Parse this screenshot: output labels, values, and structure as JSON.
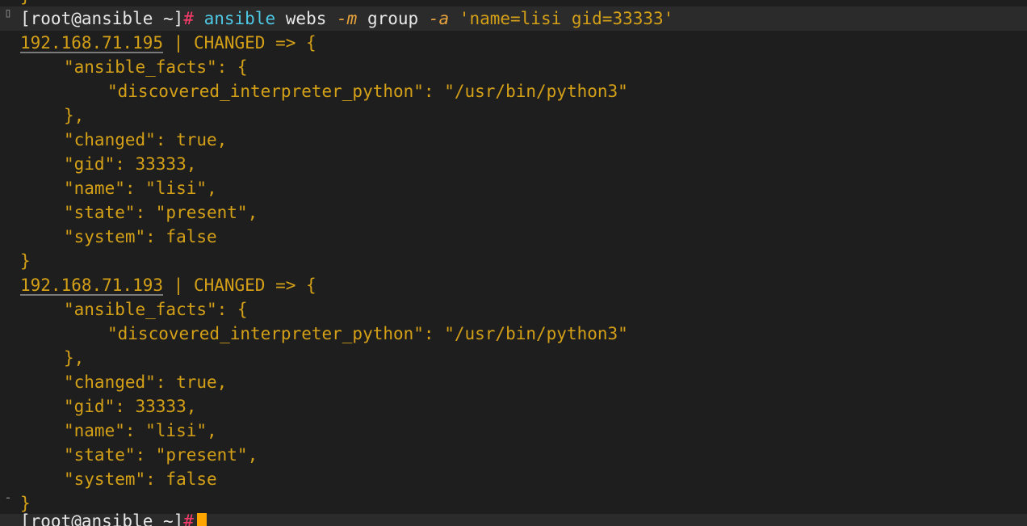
{
  "terminal": {
    "prev_brace": "}",
    "prompt": {
      "user_host": "[root@ansible ~]",
      "symbol": "#",
      "cmd_name": "ansible",
      "arg1": "webs",
      "flag_m": "-m",
      "module": "group",
      "flag_a": "-a",
      "args": "'name=lisi gid=33333'"
    },
    "results": [
      {
        "ip": "192.168.71.195",
        "status": " | CHANGED => {",
        "facts_open": "\"ansible_facts\": {",
        "interpreter": "\"discovered_interpreter_python\": \"/usr/bin/python3\"",
        "facts_close": "},",
        "changed": "\"changed\": true,",
        "gid": "\"gid\": 33333,",
        "name": "\"name\": \"lisi\",",
        "state": "\"state\": \"present\",",
        "system": "\"system\": false",
        "close": "}"
      },
      {
        "ip": "192.168.71.193",
        "status": " | CHANGED => {",
        "facts_open": "\"ansible_facts\": {",
        "interpreter": "\"discovered_interpreter_python\": \"/usr/bin/python3\"",
        "facts_close": "},",
        "changed": "\"changed\": true,",
        "gid": "\"gid\": 33333,",
        "name": "\"name\": \"lisi\",",
        "state": "\"state\": \"present\",",
        "system": "\"system\": false",
        "close": "}"
      }
    ],
    "final_prompt": {
      "user_host": "[root@ansible ~]",
      "symbol": "#"
    }
  },
  "gutter": {
    "marker_top": "▯",
    "marker_bottom": "-"
  }
}
